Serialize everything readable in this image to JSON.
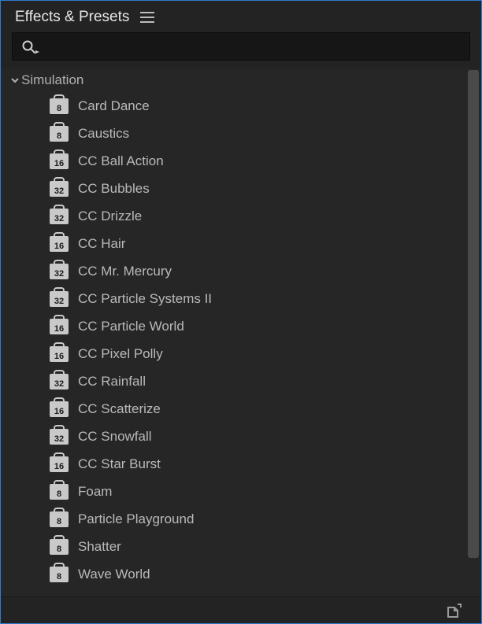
{
  "panel": {
    "title": "Effects & Presets"
  },
  "search": {
    "placeholder": ""
  },
  "category": {
    "label": "Simulation",
    "expanded": true
  },
  "effects": [
    {
      "label": "Card Dance",
      "bits": "8"
    },
    {
      "label": "Caustics",
      "bits": "8"
    },
    {
      "label": "CC Ball Action",
      "bits": "16"
    },
    {
      "label": "CC Bubbles",
      "bits": "32"
    },
    {
      "label": "CC Drizzle",
      "bits": "32"
    },
    {
      "label": "CC Hair",
      "bits": "16"
    },
    {
      "label": "CC Mr. Mercury",
      "bits": "32"
    },
    {
      "label": "CC Particle Systems II",
      "bits": "32"
    },
    {
      "label": "CC Particle World",
      "bits": "16"
    },
    {
      "label": "CC Pixel Polly",
      "bits": "16"
    },
    {
      "label": "CC Rainfall",
      "bits": "32"
    },
    {
      "label": "CC Scatterize",
      "bits": "16"
    },
    {
      "label": "CC Snowfall",
      "bits": "32"
    },
    {
      "label": "CC Star Burst",
      "bits": "16"
    },
    {
      "label": "Foam",
      "bits": "8"
    },
    {
      "label": "Particle Playground",
      "bits": "8"
    },
    {
      "label": "Shatter",
      "bits": "8"
    },
    {
      "label": "Wave World",
      "bits": "8"
    }
  ]
}
